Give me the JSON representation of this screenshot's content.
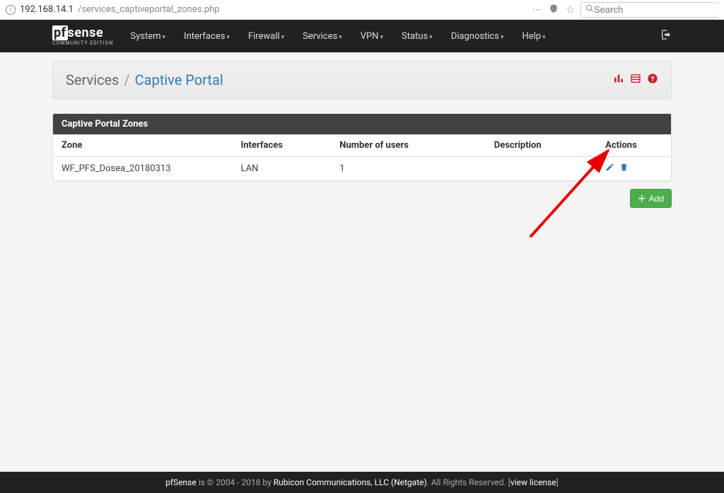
{
  "url": {
    "host": "192.168.14.1",
    "path": "/services_captiveportal_zones.php"
  },
  "search_placeholder": "Search",
  "nav": {
    "items": [
      "System",
      "Interfaces",
      "Firewall",
      "Services",
      "VPN",
      "Status",
      "Diagnostics",
      "Help"
    ]
  },
  "brand": {
    "name": "sense",
    "prefix": "pf",
    "sub": "COMMUNITY EDITION"
  },
  "breadcrumb": {
    "a": "Services",
    "b": "Captive Portal"
  },
  "panel_title": "Captive Portal Zones",
  "columns": {
    "zone": "Zone",
    "interfaces": "Interfaces",
    "users": "Number of users",
    "desc": "Description",
    "actions": "Actions"
  },
  "rows": [
    {
      "zone": "WF_PFS_Dosea_20180313",
      "interfaces": "LAN",
      "users": "1",
      "desc": ""
    }
  ],
  "add_label": "Add",
  "footer": {
    "product": "pfSense",
    "mid": " is © 2004 - 2018 by ",
    "company": "Rubicon Communications, LLC (Netgate)",
    "tail": ". All Rights Reserved. ",
    "link": "view license"
  }
}
